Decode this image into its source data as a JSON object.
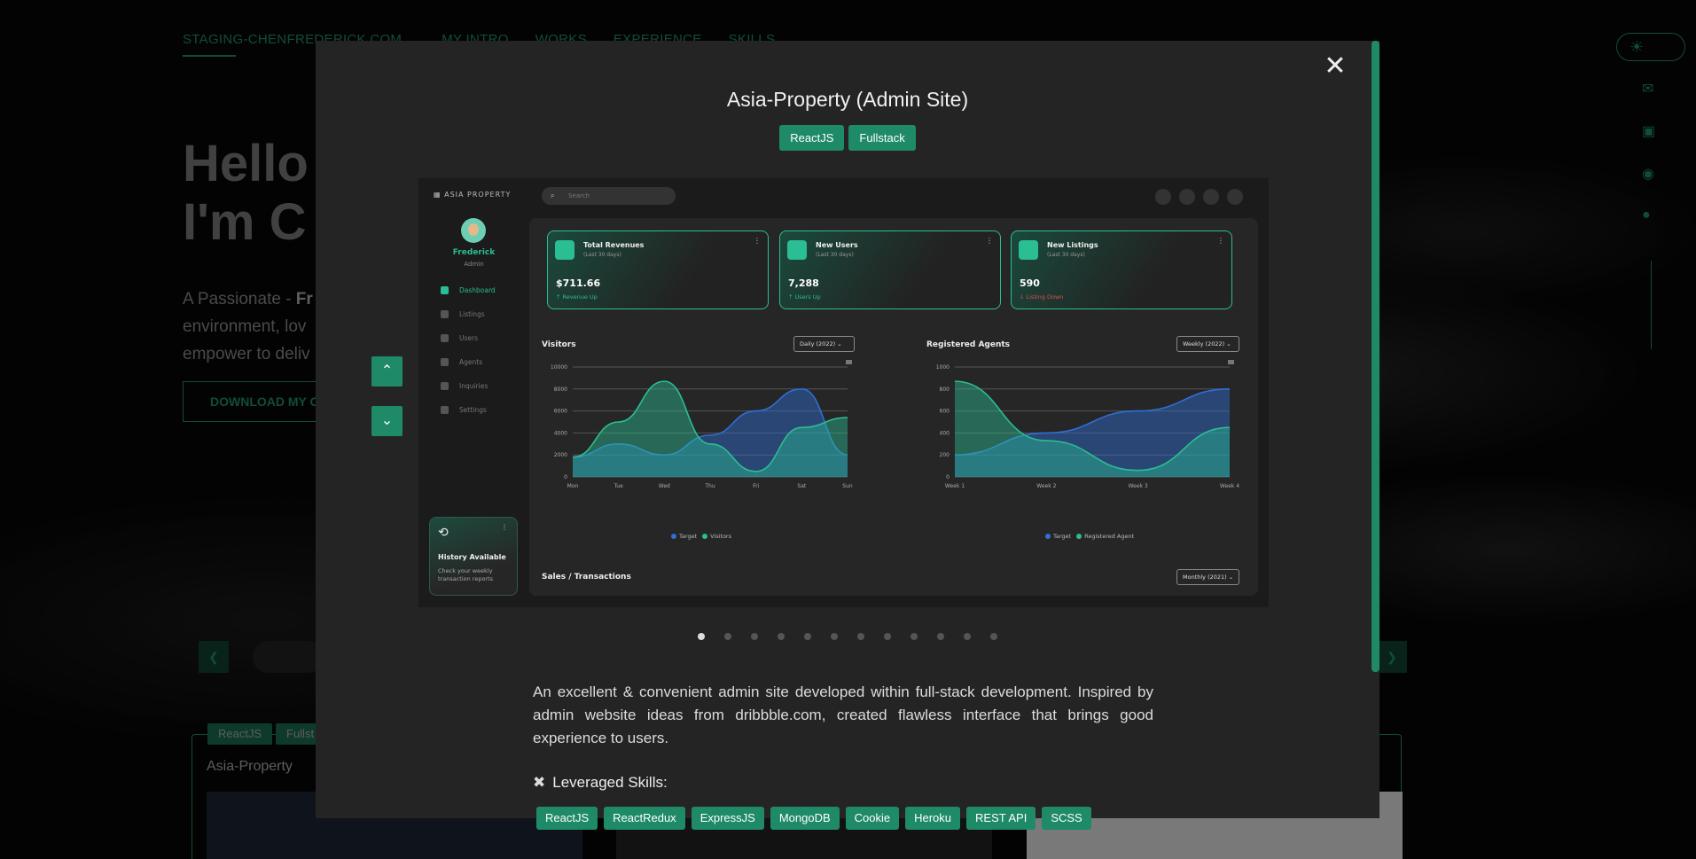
{
  "background": {
    "nav": {
      "brand": "STAGING-CHENFREDERICK.COM",
      "items": [
        "MY INTRO",
        "WORKS",
        "EXPERIENCE",
        "SKILLS"
      ]
    },
    "hero": {
      "line1": "Hello",
      "line2": "I'm C",
      "sub1_prefix": "A Passionate - ",
      "sub1_bold": "Fr",
      "sub2": "environment, lov",
      "sub3": "empower to deliv"
    },
    "download_label": "DOWNLOAD MY C",
    "card": {
      "tags": [
        "ReactJS",
        "Fullst"
      ],
      "title": "Asia-Property"
    }
  },
  "modal": {
    "title": "Asia-Property (Admin Site)",
    "tags": [
      "ReactJS",
      "Fullstack"
    ],
    "description": "An excellent & convenient admin site developed within full-stack development. Inspired by admin website ideas from dribbble.com, created flawless interface that brings good experience to users.",
    "skills_title": "Leveraged Skills:",
    "skills": [
      "ReactJS",
      "ReactRedux",
      "ExpressJS",
      "MongoDB",
      "Cookie",
      "Heroku",
      "REST API",
      "SCSS"
    ],
    "slide_count": 12,
    "active_slide": 0
  },
  "screenshot": {
    "brand": "ASIA PROPERTY",
    "search_placeholder": "Search",
    "user": {
      "name": "Frederick",
      "role": "Admin"
    },
    "menu": [
      "Dashboard",
      "Listings",
      "Users",
      "Agents",
      "Inquiries",
      "Settings"
    ],
    "history": {
      "title": "History Available",
      "desc": "Check your weekly transaction reports"
    },
    "stats": [
      {
        "title": "Total Revenues",
        "period": "(Last 30 days)",
        "value": "$711.66",
        "delta": "Revenue Up",
        "trend": "up"
      },
      {
        "title": "New Users",
        "period": "(Last 30 days)",
        "value": "7,288",
        "delta": "Users Up",
        "trend": "up"
      },
      {
        "title": "New Listings",
        "period": "(Last 30 days)",
        "value": "590",
        "delta": "Listing Down",
        "trend": "down"
      }
    ],
    "visitors": {
      "title": "Visitors",
      "select": "Daily (2022)"
    },
    "agents": {
      "title": "Registered Agents",
      "select": "Weekly (2022)"
    },
    "sales": {
      "title": "Sales / Transactions",
      "select": "Monthly (2021)"
    }
  },
  "chart_data": [
    {
      "type": "area",
      "categories": [
        "Mon",
        "Tue",
        "Wed",
        "Thu",
        "Fri",
        "Sat",
        "Sun"
      ],
      "ylim": [
        0,
        10000
      ],
      "yticks": [
        0,
        2000,
        4000,
        6000,
        8000,
        10000
      ],
      "series": [
        {
          "name": "Target",
          "color": "#2f6fd6",
          "values": [
            1800,
            3000,
            2000,
            3800,
            6000,
            8000,
            2000
          ]
        },
        {
          "name": "Visitors",
          "color": "#2bbd93",
          "values": [
            1800,
            5000,
            8700,
            3000,
            500,
            4500,
            5400
          ]
        }
      ]
    },
    {
      "type": "area",
      "categories": [
        "Week 1",
        "Week 2",
        "Week 3",
        "Week 4"
      ],
      "ylim": [
        0,
        1000
      ],
      "yticks": [
        0,
        200,
        400,
        600,
        800,
        1000
      ],
      "series": [
        {
          "name": "Target",
          "color": "#2f6fd6",
          "values": [
            200,
            400,
            600,
            800
          ]
        },
        {
          "name": "Registered Agent",
          "color": "#2bbd93",
          "values": [
            870,
            330,
            60,
            450
          ]
        }
      ]
    }
  ],
  "colors": {
    "accent": "#1f8a68",
    "teal": "#2bbd93",
    "blue": "#2f6fd6",
    "modal_bg": "#242424"
  }
}
